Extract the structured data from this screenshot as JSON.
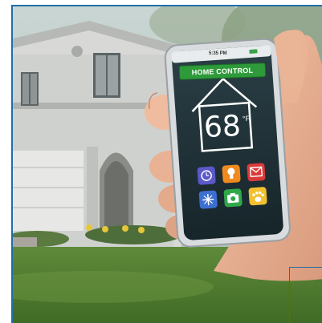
{
  "phone": {
    "status_time": "5:35 PM",
    "banner": "HOME CONTROL",
    "temperature": "68",
    "unit": "F"
  },
  "colors": {
    "frame_border": "#1f6fa8",
    "banner_green": "#2e9a3a",
    "screen_dark": "#1c2d33"
  },
  "icons": [
    "clock-icon",
    "lightbulb-icon",
    "mail-icon",
    "snowflake-icon",
    "camera-icon",
    "paw-icon"
  ]
}
